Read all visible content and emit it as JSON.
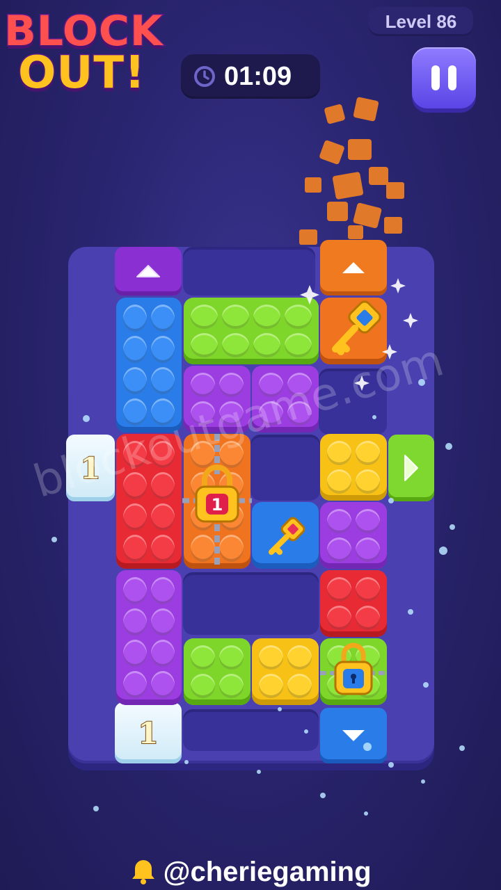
{
  "logo": {
    "line1": "BLOCK",
    "line2": "OUT!"
  },
  "level": {
    "label": "Level 86"
  },
  "timer": {
    "value": "01:09"
  },
  "pause": {
    "icon": "pause-icon"
  },
  "ice_tiles": [
    {
      "count": "1"
    },
    {
      "count": "1"
    }
  ],
  "locks": [
    {
      "count": "1"
    }
  ],
  "watermark": "blockoutgame.com",
  "social": {
    "handle": "@cheriegaming",
    "icon": "bell-icon"
  },
  "colors": {
    "background": "#2a2570",
    "board": "#4a40b0",
    "blue": "#2a7ce8",
    "green": "#7ed62a",
    "purple": "#9b3de0",
    "red": "#e82a34",
    "orange": "#f0731f",
    "yellow": "#f7c115"
  }
}
